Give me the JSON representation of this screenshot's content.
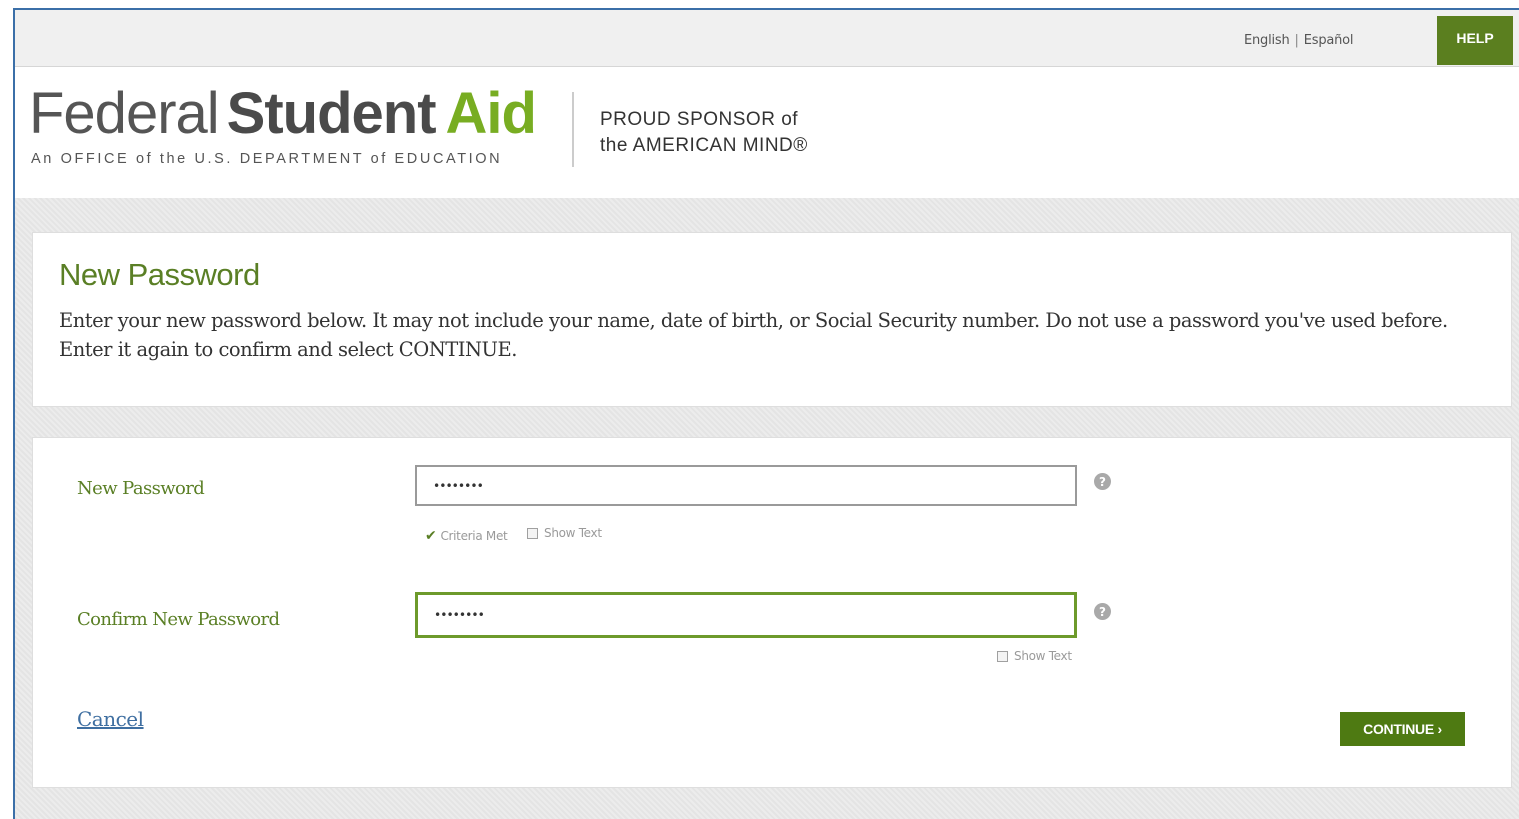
{
  "topbar": {
    "lang_english": "English",
    "lang_separator": "|",
    "lang_spanish": "Español",
    "help_label": "HELP"
  },
  "header": {
    "logo_word1": "Federal",
    "logo_word2": "Student",
    "logo_word3": "Aid",
    "logo_subtitle": "An OFFICE of the U.S. DEPARTMENT of EDUCATION",
    "sponsor_text": "PROUD SPONSOR of\nthe AMERICAN MIND®"
  },
  "intro": {
    "title": "New Password",
    "description": "Enter your new password below. It may not include your name, date of birth, or Social Security number. Do not use a password you've used before. Enter it again to confirm and select CONTINUE."
  },
  "form": {
    "new_password_label": "New Password",
    "new_password_value": "••••••••",
    "criteria_met_label": "Criteria Met",
    "show_text_label": "Show Text",
    "confirm_password_label": "Confirm New Password",
    "confirm_password_value": "••••••••",
    "confirm_show_text_label": "Show Text",
    "help_icon_glyph": "?",
    "cancel_label": "Cancel",
    "continue_label": "CONTINUE ›"
  },
  "colors": {
    "brand_green": "#5b7f1f",
    "logo_green": "#78ad22",
    "link_blue": "#3f6fa1"
  }
}
